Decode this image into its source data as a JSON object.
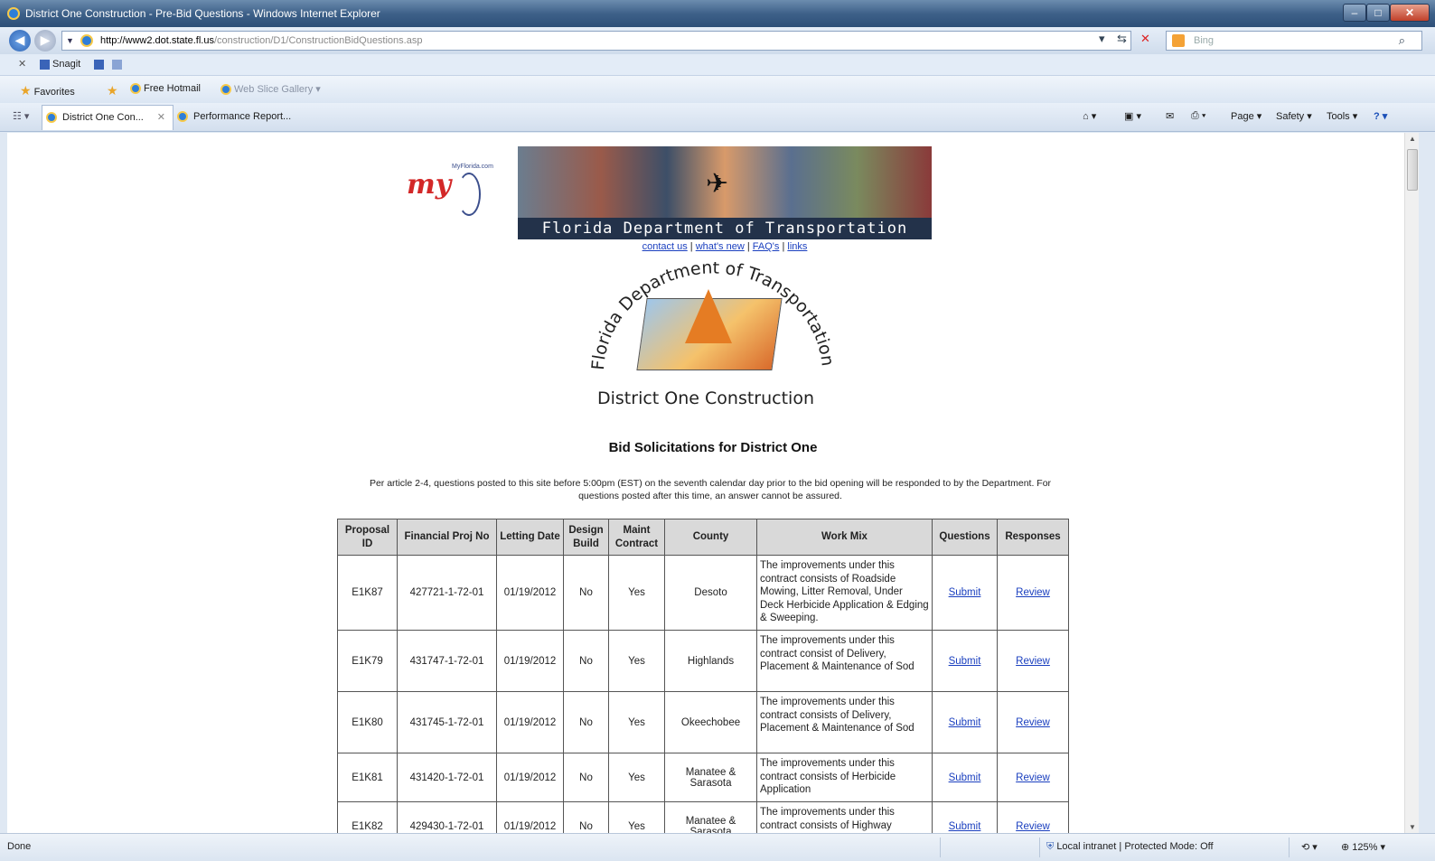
{
  "browser": {
    "window_title": "District One Construction - Pre-Bid Questions - Windows Internet Explorer",
    "address_host": "http://www2.dot.state.fl.us",
    "address_path": "/construction/D1/ConstructionBidQuestions.asp",
    "search_placeholder": "Bing",
    "snagit_label": "Snagit",
    "favorites_label": "Favorites",
    "fav_link_1": "Free Hotmail",
    "fav_link_2": "Web Slice Gallery ▾",
    "tabs": [
      {
        "label": "District One Con..."
      },
      {
        "label": "Performance Report..."
      }
    ],
    "commands": {
      "page": "Page ▾",
      "safety": "Safety ▾",
      "tools": "Tools ▾"
    },
    "status_text": "Done",
    "zone_text": "Local intranet | Protected Mode: Off",
    "zoom_text": "125%"
  },
  "page": {
    "banner_title": "Florida Department of Transportation",
    "logo_text": "my",
    "logo_tag": "MyFlorida.com",
    "top_links": [
      "contact us",
      "what's new",
      "FAQ's",
      "links"
    ],
    "seal_text": "Florida Department of Transportation",
    "seal_caption": "District One Construction",
    "heading": "Bid Solicitations for District One",
    "note": "Per article 2-4, questions posted to this site before 5:00pm (EST) on the seventh calendar day prior to the bid opening will be responded to by the Department. For questions posted after this time, an answer cannot be assured.",
    "table_headers": [
      "Proposal ID",
      "Financial Proj No",
      "Letting Date",
      "Design Build",
      "Maint Contract",
      "County",
      "Work Mix",
      "Questions",
      "Responses"
    ],
    "rows": [
      {
        "id": "E1K87",
        "fin": "427721-1-72-01",
        "date": "01/19/2012",
        "db": "No",
        "maint": "Yes",
        "county": "Desoto",
        "workmix": "The improvements under this contract consists of Roadside Mowing, Litter Removal, Under Deck Herbicide Application & Edging & Sweeping.",
        "questions": "Submit",
        "responses": "Review"
      },
      {
        "id": "E1K79",
        "fin": "431747-1-72-01",
        "date": "01/19/2012",
        "db": "No",
        "maint": "Yes",
        "county": "Highlands",
        "workmix": "The improvements under this contract consist of Delivery, Placement & Maintenance of Sod",
        "questions": "Submit",
        "responses": "Review"
      },
      {
        "id": "E1K80",
        "fin": "431745-1-72-01",
        "date": "01/19/2012",
        "db": "No",
        "maint": "Yes",
        "county": "Okeechobee",
        "workmix": "The improvements under this contract consists of Delivery, Placement & Maintenance of Sod",
        "questions": "Submit",
        "responses": "Review"
      },
      {
        "id": "E1K81",
        "fin": "431420-1-72-01",
        "date": "01/19/2012",
        "db": "No",
        "maint": "Yes",
        "county": "Manatee & Sarasota",
        "workmix": "The improvements under this contract consists of Herbicide Application",
        "questions": "Submit",
        "responses": "Review"
      },
      {
        "id": "E1K82",
        "fin": "429430-1-72-01",
        "date": "01/19/2012",
        "db": "No",
        "maint": "Yes",
        "county": "Manatee & Sarasota",
        "workmix": "The improvements under this contract consists of Highway",
        "questions": "Submit",
        "responses": "Review"
      }
    ]
  }
}
